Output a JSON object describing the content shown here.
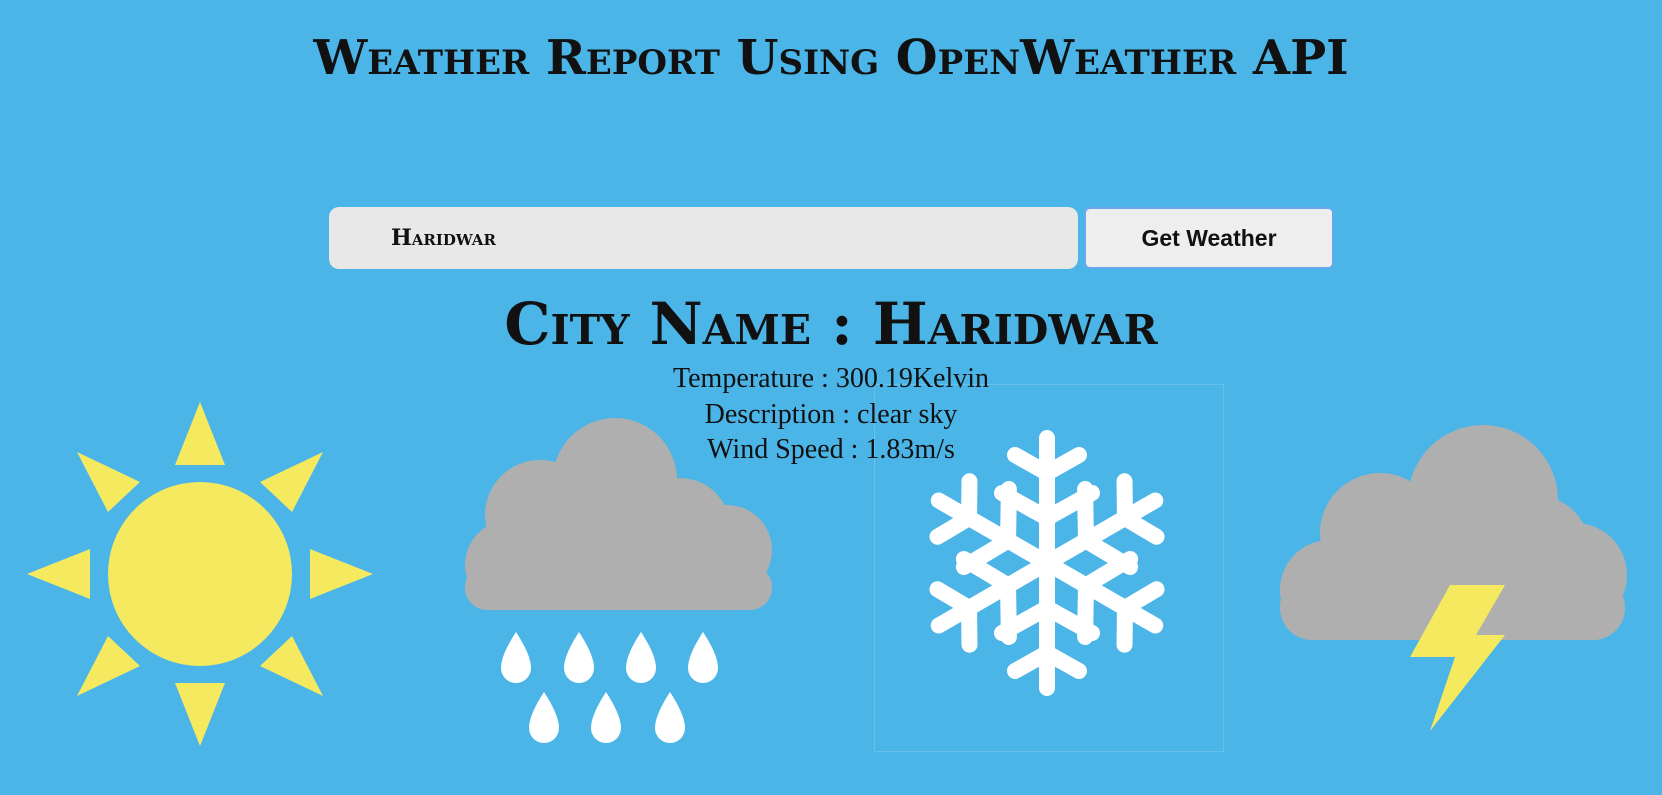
{
  "header": {
    "title": "Weather Report Using OpenWeather API"
  },
  "search": {
    "value": "Haridwar",
    "button_label": "Get Weather"
  },
  "result": {
    "city_label": "City Name : Haridwar",
    "temperature": "Temperature : 300.19Kelvin",
    "description": "Description : clear sky",
    "wind_speed": "Wind Speed : 1.83m/s"
  },
  "icons": [
    "sun-icon",
    "rain-cloud-icon",
    "snowflake-icon",
    "thunderstorm-icon"
  ],
  "colors": {
    "background": "#4bb5e8",
    "sun": "#f5e960",
    "cloud": "#afafaf",
    "drop": "#ffffff",
    "bolt": "#f5e960"
  }
}
